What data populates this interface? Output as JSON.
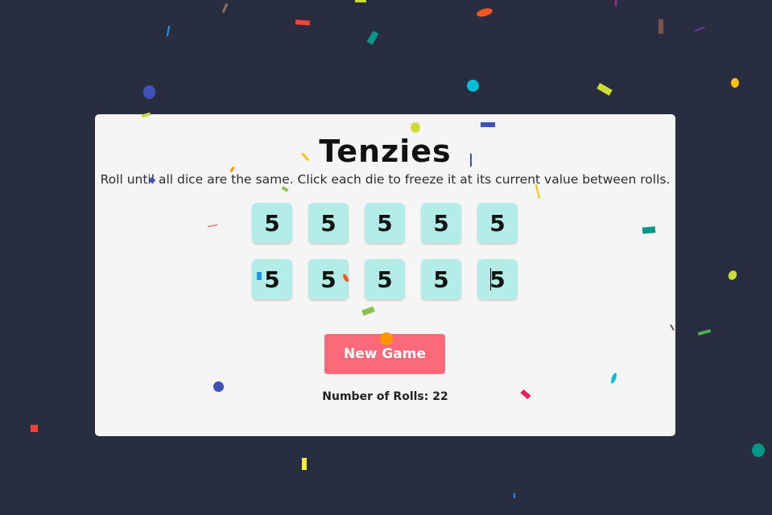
{
  "game": {
    "title": "Tenzies",
    "instructions": "Roll until all dice are the same. Click each die to freeze it at its current value between rolls.",
    "dice": [
      "5",
      "5",
      "5",
      "5",
      "5",
      "5",
      "5",
      "5",
      "5",
      "5"
    ],
    "new_game_label": "New Game",
    "rolls_label": "Number of Rolls: 22"
  },
  "colors": {
    "background": "#282d40",
    "card": "#f5f5f5",
    "die": "#b4ede8",
    "button": "#fc6a7a"
  }
}
